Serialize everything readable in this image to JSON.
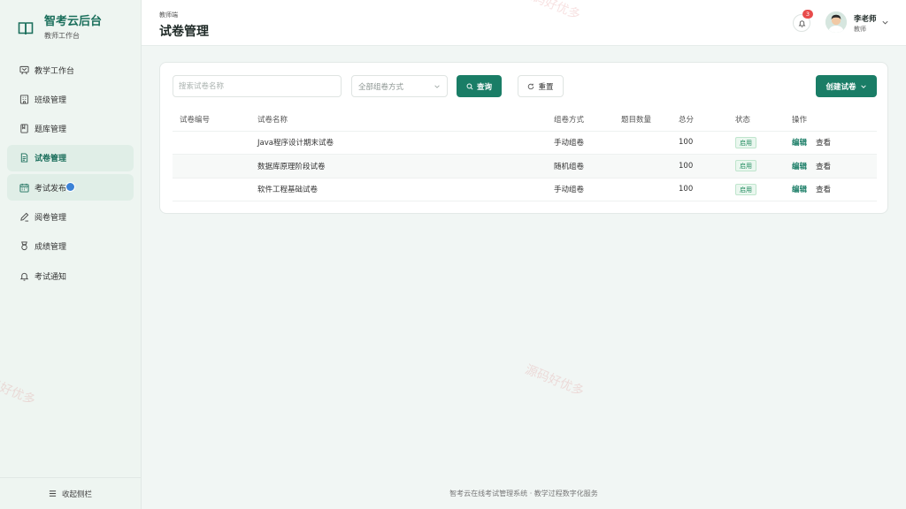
{
  "brand": {
    "title": "智考云后台",
    "subtitle": "教师工作台"
  },
  "sidebar": {
    "items": [
      {
        "label": "教学工作台",
        "icon": "chalkboard-icon"
      },
      {
        "label": "班级管理",
        "icon": "building-icon"
      },
      {
        "label": "题库管理",
        "icon": "book-icon"
      },
      {
        "label": "试卷管理",
        "icon": "document-icon",
        "active": true
      },
      {
        "label": "考试发布",
        "icon": "calendar-icon"
      },
      {
        "label": "阅卷管理",
        "icon": "pen-icon"
      },
      {
        "label": "成绩管理",
        "icon": "medal-icon"
      },
      {
        "label": "考试通知",
        "icon": "bell-icon"
      }
    ],
    "collapse_label": "收起侧栏"
  },
  "header": {
    "breadcrumb": "教师端",
    "title": "试卷管理",
    "notification_count": "3",
    "user": {
      "name": "李老师",
      "role": "教师"
    }
  },
  "filters": {
    "search_placeholder": "搜索试卷名称",
    "mode_select": "全部组卷方式",
    "query_label": "查询",
    "reset_label": "重置",
    "create_label": "创建试卷"
  },
  "table": {
    "columns": [
      "试卷编号",
      "试卷名称",
      "组卷方式",
      "题目数量",
      "总分",
      "状态",
      "操作"
    ],
    "rows": [
      {
        "id": "",
        "name": "Java程序设计期末试卷",
        "mode": "手动组卷",
        "count": "",
        "score": "100",
        "status": "启用",
        "edit": "编辑",
        "view": "查看"
      },
      {
        "id": "",
        "name": "数据库原理阶段试卷",
        "mode": "随机组卷",
        "count": "",
        "score": "100",
        "status": "启用",
        "edit": "编辑",
        "view": "查看"
      },
      {
        "id": "",
        "name": "软件工程基础试卷",
        "mode": "手动组卷",
        "count": "",
        "score": "100",
        "status": "启用",
        "edit": "编辑",
        "view": "查看"
      }
    ]
  },
  "footer": "智考云在线考试管理系统 · 教学过程数字化服务",
  "watermark": "源码好优多",
  "colors": {
    "primary": "#1a7d66",
    "sidebar_bg": "#eef5f1",
    "page_bg": "#f1f6f4",
    "badge": "#e84b4b",
    "status_green": "#1f8a5d"
  }
}
